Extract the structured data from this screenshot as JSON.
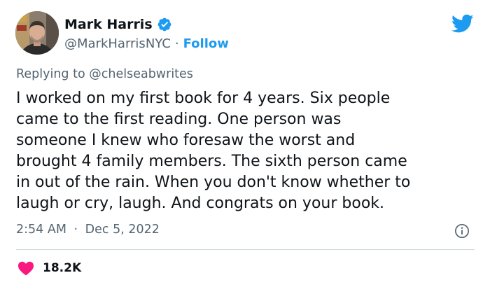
{
  "author": {
    "display_name": "Mark Harris",
    "handle": "@MarkHarrisNYC",
    "separator": "·",
    "follow_label": "Follow",
    "verified": true
  },
  "reply": {
    "prefix": "Replying to",
    "mention": "@chelseabwrites"
  },
  "tweet": {
    "lines": [
      "I worked on my first book for 4 years. Six people",
      "came to the first reading. One person was",
      "someone I knew who foresaw the worst and",
      "brought 4 family members. The sixth person came",
      "in out of the rain. When you don't know whether to",
      "laugh or cry, laugh. And congrats on your book."
    ]
  },
  "meta": {
    "time": "2:54 AM",
    "separator": "·",
    "date": "Dec 5, 2022"
  },
  "engagement": {
    "likes": "18.2K"
  },
  "icons": {
    "brand": "twitter-bird-icon",
    "verified": "verified-badge-icon",
    "info": "info-icon",
    "like": "heart-icon"
  },
  "colors": {
    "brand_blue": "#1d9bf0",
    "heart_red": "#f91880",
    "text_primary": "#0f1419",
    "text_secondary": "#536471",
    "divider": "#cfd9de"
  }
}
